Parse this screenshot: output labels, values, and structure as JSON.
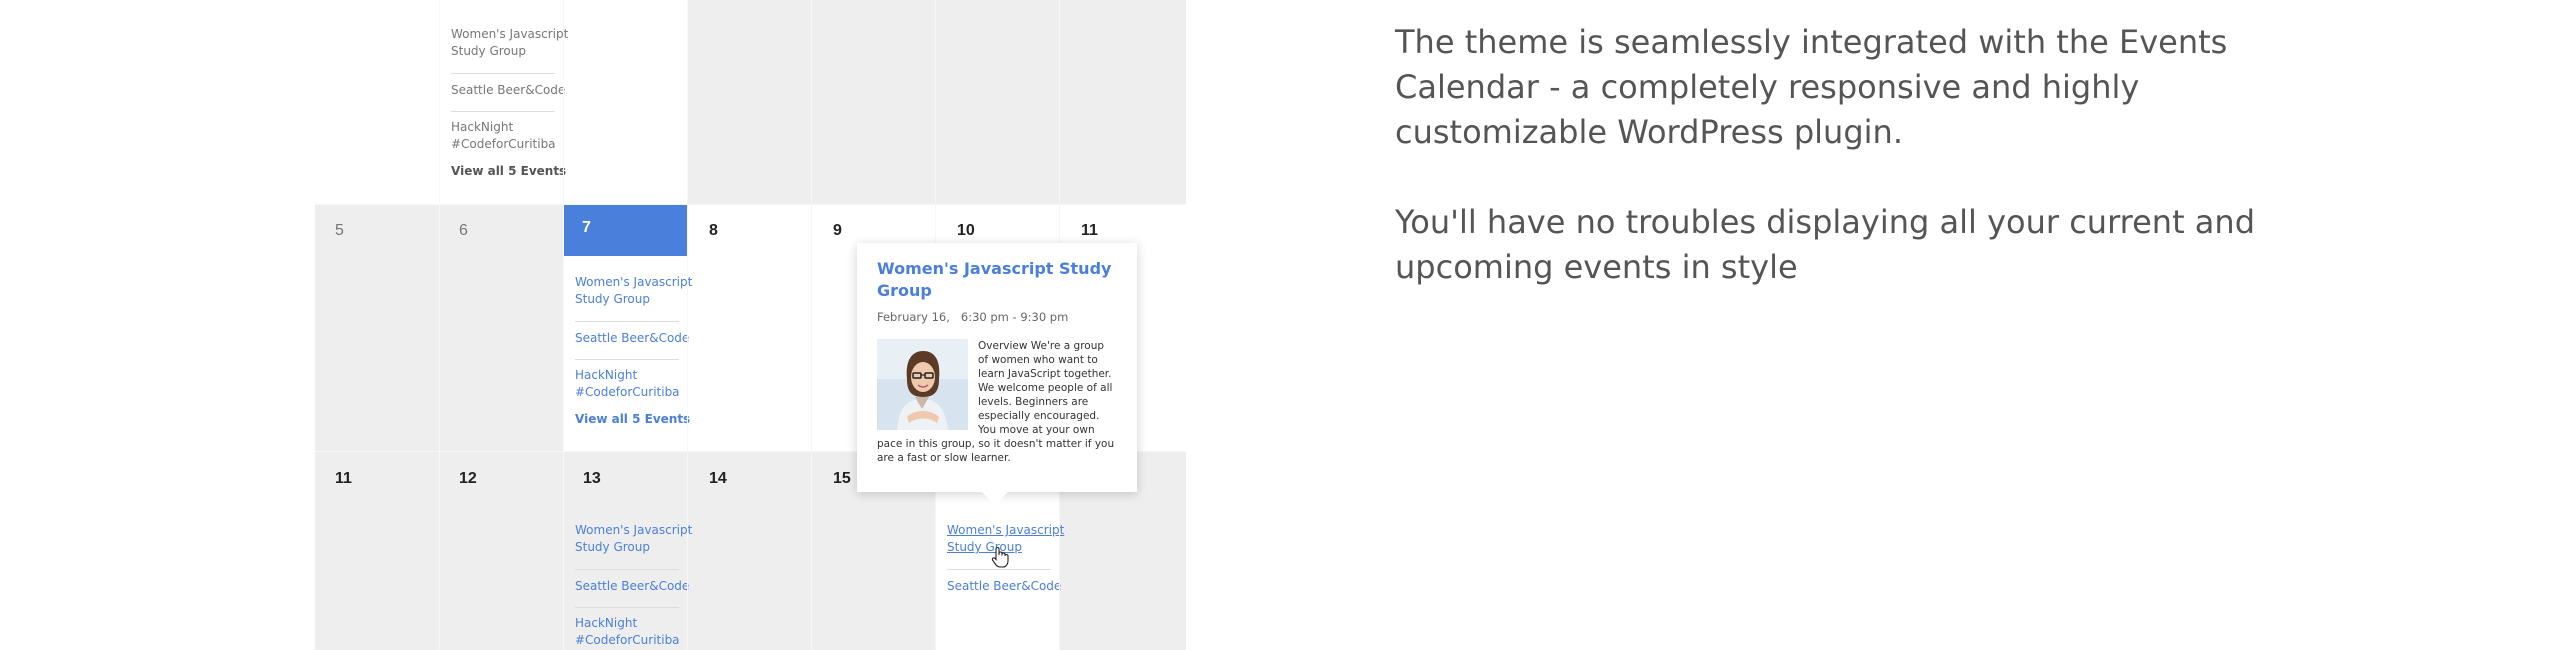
{
  "calendar": {
    "rows": [
      {
        "days": [
          "",
          "",
          "",
          "",
          "",
          "",
          ""
        ],
        "col3_events": [
          "Women's Javascript Study Group",
          "Seattle Beer&Code",
          "HackNight #CodeforCuritiba"
        ],
        "col3_viewall": "View all 5 Events"
      },
      {
        "days": [
          "5",
          "6",
          "7",
          "8",
          "9",
          "10",
          "11"
        ],
        "col3_events": [
          "Women's Javascript Study Group",
          "Seattle Beer&Code",
          "HackNight #CodeforCuritiba"
        ],
        "col3_viewall": "View all 5 Events"
      },
      {
        "days": [
          "11",
          "12",
          "13",
          "14",
          "15",
          "",
          ""
        ],
        "col3_events": [
          "Women's Javascript Study Group",
          "Seattle Beer&Code",
          "HackNight #CodeforCuritiba"
        ],
        "col6_events": [
          "Women's Javascript Study Group",
          "Seattle Beer&Code"
        ]
      }
    ]
  },
  "tooltip": {
    "title": "Women's Javascript Study Group",
    "date": "February 16,",
    "time": "6:30 pm - 9:30 pm",
    "description": "Overview We're a group of women who want to learn JavaScript together. We welcome people of all levels. Beginners are especially encouraged. You move at your own pace in this group, so it doesn't matter if you are a fast or slow learner."
  },
  "right_panel": {
    "paragraph1": "The theme is seamlessly integrated with the Events Calendar - a completely responsive and highly customizable WordPress plugin.",
    "paragraph2": "You'll have no troubles displaying all your current and upcoming events in style"
  },
  "colors": {
    "accent": "#4a7fdb",
    "past_bg": "#eeeeee",
    "text_gray": "#555555"
  },
  "icons": {
    "cursor": "hand-pointer-icon"
  }
}
